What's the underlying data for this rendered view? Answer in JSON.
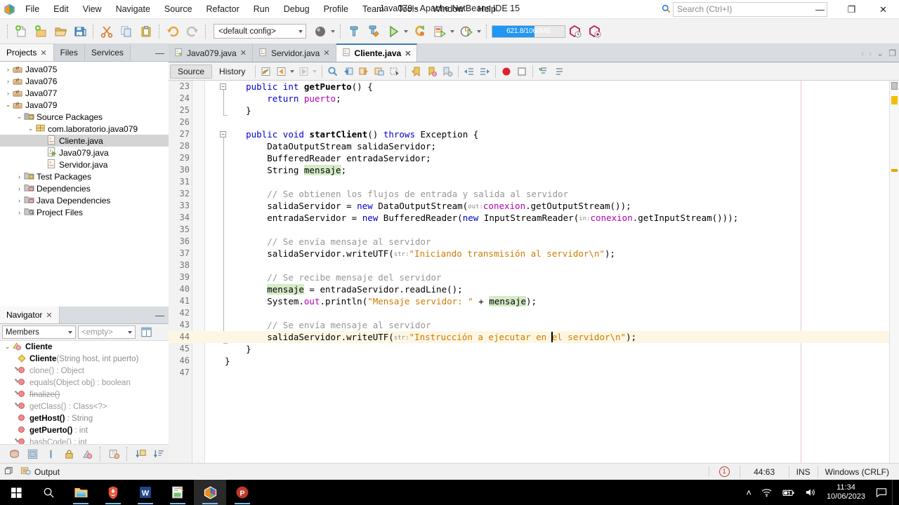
{
  "titlebar": {
    "app_title": "Java079 - Apache NetBeans IDE 15",
    "menus": [
      "File",
      "Edit",
      "View",
      "Navigate",
      "Source",
      "Refactor",
      "Run",
      "Debug",
      "Profile",
      "Team",
      "Tools",
      "Window",
      "Help"
    ],
    "search_placeholder": "Search (Ctrl+I)",
    "minimize": "—",
    "maximize": "❐",
    "close": "✕"
  },
  "toolbar": {
    "config_label": "<default config>",
    "memory_label": "621.8/1066MB",
    "memory_percent": 58,
    "buttons": [
      "new-file-icon",
      "new-project-icon",
      "open-project-icon",
      "save-all-icon",
      "cut-icon",
      "copy-icon",
      "paste-icon",
      "undo-icon",
      "redo-icon",
      "build-icon",
      "clean-build-icon",
      "run-icon",
      "debug-icon",
      "profile-icon",
      "test-icon"
    ]
  },
  "left_dock": {
    "tabs": [
      {
        "label": "Projects",
        "active": true,
        "closable": true
      },
      {
        "label": "Files",
        "active": false,
        "closable": false
      },
      {
        "label": "Services",
        "active": false,
        "closable": false
      }
    ],
    "minimize_glyph": "—",
    "tree": [
      {
        "label": "Java075",
        "depth": 0,
        "expander": "›",
        "icon": "java-project-icon",
        "selected": false
      },
      {
        "label": "Java076",
        "depth": 0,
        "expander": "›",
        "icon": "java-project-icon",
        "selected": false
      },
      {
        "label": "Java077",
        "depth": 0,
        "expander": "›",
        "icon": "java-project-icon",
        "selected": false
      },
      {
        "label": "Java079",
        "depth": 0,
        "expander": "⌄",
        "icon": "java-project-icon",
        "selected": false
      },
      {
        "label": "Source Packages",
        "depth": 1,
        "expander": "⌄",
        "icon": "source-packages-icon",
        "selected": false
      },
      {
        "label": "com.laboratorio.java079",
        "depth": 2,
        "expander": "⌄",
        "icon": "package-icon",
        "selected": false
      },
      {
        "label": "Cliente.java",
        "depth": 3,
        "expander": "",
        "icon": "java-class-icon",
        "selected": true
      },
      {
        "label": "Java079.java",
        "depth": 3,
        "expander": "",
        "icon": "java-main-class-icon",
        "selected": false
      },
      {
        "label": "Servidor.java",
        "depth": 3,
        "expander": "",
        "icon": "java-class-icon",
        "selected": false
      },
      {
        "label": "Test Packages",
        "depth": 1,
        "expander": "›",
        "icon": "test-packages-icon",
        "selected": false
      },
      {
        "label": "Dependencies",
        "depth": 1,
        "expander": "›",
        "icon": "dependencies-icon",
        "selected": false
      },
      {
        "label": "Java Dependencies",
        "depth": 1,
        "expander": "›",
        "icon": "dependencies-icon",
        "selected": false
      },
      {
        "label": "Project Files",
        "depth": 1,
        "expander": "›",
        "icon": "project-files-icon",
        "selected": false
      }
    ]
  },
  "navigator": {
    "tab_label": "Navigator",
    "minimize_glyph": "—",
    "view_select": "Members",
    "filter_select": "<empty>",
    "class_name": "Cliente",
    "members": [
      {
        "name": "Cliente",
        "signature": "(String host, int puerto)",
        "return_type": "",
        "icon": "constructor-icon",
        "inherited": false,
        "deprecated": false
      },
      {
        "name": "clone()",
        "signature": "",
        "return_type": " : Object",
        "icon": "method-icon",
        "inherited": true,
        "deprecated": false
      },
      {
        "name": "equals(Object obj)",
        "signature": "",
        "return_type": " : boolean",
        "icon": "method-icon",
        "inherited": true,
        "deprecated": false
      },
      {
        "name": "finalize()",
        "signature": "",
        "return_type": "",
        "icon": "method-icon",
        "inherited": true,
        "deprecated": true
      },
      {
        "name": "getClass()",
        "signature": "",
        "return_type": " : Class<?>",
        "icon": "method-icon",
        "inherited": true,
        "deprecated": false
      },
      {
        "name": "getHost()",
        "signature": "",
        "return_type": " : String",
        "icon": "method-icon",
        "inherited": false,
        "deprecated": false
      },
      {
        "name": "getPuerto()",
        "signature": "",
        "return_type": " : int",
        "icon": "method-icon",
        "inherited": false,
        "deprecated": false
      },
      {
        "name": "hashCode()",
        "signature": "",
        "return_type": " : int",
        "icon": "method-icon",
        "inherited": true,
        "deprecated": false
      }
    ]
  },
  "editor": {
    "tabs": [
      {
        "label": "Java079.java",
        "active": false,
        "icon": "java-main-class-icon"
      },
      {
        "label": "Servidor.java",
        "active": false,
        "icon": "java-class-icon"
      },
      {
        "label": "Cliente.java",
        "active": true,
        "icon": "java-class-icon"
      }
    ],
    "tab_controls": [
      "‹",
      "›",
      "⌄",
      "❐"
    ],
    "view_buttons": [
      {
        "label": "Source",
        "active": true
      },
      {
        "label": "History",
        "active": false
      }
    ],
    "toolbar_icons": [
      "last-edit-icon",
      "back-icon",
      "forward-icon",
      "find-selection-icon",
      "previous-bookmark-icon",
      "next-bookmark-icon",
      "toggle-bookmark-icon",
      "shift-line-icon",
      "previous-error-icon",
      "next-error-icon",
      "toggle-highlight-icon",
      "shift-left-icon",
      "shift-right-icon",
      "toggle-breakpoint-icon",
      "stop-icon",
      "comment-icon",
      "uncomment-icon"
    ],
    "caret_position": "44:63",
    "code_lines": [
      {
        "no": 23,
        "indent": 4,
        "tokens": [
          {
            "t": "public",
            "c": "kw"
          },
          {
            "t": " ",
            "c": ""
          },
          {
            "t": "int",
            "c": "kw"
          },
          {
            "t": " ",
            "c": ""
          },
          {
            "t": "getPuerto",
            "c": "mth"
          },
          {
            "t": "() {",
            "c": ""
          }
        ]
      },
      {
        "no": 24,
        "indent": 8,
        "tokens": [
          {
            "t": "return",
            "c": "kw"
          },
          {
            "t": " ",
            "c": ""
          },
          {
            "t": "puerto",
            "c": "fld"
          },
          {
            "t": ";",
            "c": ""
          }
        ]
      },
      {
        "no": 25,
        "indent": 4,
        "tokens": [
          {
            "t": "}",
            "c": ""
          }
        ]
      },
      {
        "no": 26,
        "indent": 0,
        "tokens": []
      },
      {
        "no": 27,
        "indent": 4,
        "tokens": [
          {
            "t": "public",
            "c": "kw"
          },
          {
            "t": " ",
            "c": ""
          },
          {
            "t": "void",
            "c": "kw"
          },
          {
            "t": " ",
            "c": ""
          },
          {
            "t": "startClient",
            "c": "mth"
          },
          {
            "t": "() ",
            "c": ""
          },
          {
            "t": "throws",
            "c": "kw"
          },
          {
            "t": " Exception {",
            "c": ""
          }
        ]
      },
      {
        "no": 28,
        "indent": 8,
        "tokens": [
          {
            "t": "DataOutputStream salidaServidor;",
            "c": ""
          }
        ]
      },
      {
        "no": 29,
        "indent": 8,
        "tokens": [
          {
            "t": "BufferedReader entradaServidor;",
            "c": ""
          }
        ]
      },
      {
        "no": 30,
        "indent": 8,
        "tokens": [
          {
            "t": "String ",
            "c": ""
          },
          {
            "t": "mensaje",
            "c": "hl"
          },
          {
            "t": ";",
            "c": ""
          }
        ]
      },
      {
        "no": 31,
        "indent": 0,
        "tokens": []
      },
      {
        "no": 32,
        "indent": 8,
        "tokens": [
          {
            "t": "// Se obtienen los flujos de entrada y salida al servidor",
            "c": "cm"
          }
        ]
      },
      {
        "no": 33,
        "indent": 8,
        "tokens": [
          {
            "t": "salidaServidor = ",
            "c": ""
          },
          {
            "t": "new",
            "c": "kw"
          },
          {
            "t": " DataOutputStream(",
            "c": ""
          },
          {
            "t": "out:",
            "c": "hint"
          },
          {
            "t": "",
            "c": ""
          },
          {
            "t": "conexion",
            "c": "fld"
          },
          {
            "t": ".getOutputStream());",
            "c": ""
          }
        ]
      },
      {
        "no": 34,
        "indent": 8,
        "tokens": [
          {
            "t": "entradaServidor = ",
            "c": ""
          },
          {
            "t": "new",
            "c": "kw"
          },
          {
            "t": " BufferedReader(",
            "c": ""
          },
          {
            "t": "new",
            "c": "kw"
          },
          {
            "t": " InputStreamReader(",
            "c": ""
          },
          {
            "t": "in:",
            "c": "hint"
          },
          {
            "t": "",
            "c": ""
          },
          {
            "t": "conexion",
            "c": "fld"
          },
          {
            "t": ".getInputStream()));",
            "c": ""
          }
        ]
      },
      {
        "no": 35,
        "indent": 0,
        "tokens": []
      },
      {
        "no": 36,
        "indent": 8,
        "tokens": [
          {
            "t": "// Se envía mensaje al servidor",
            "c": "cm"
          }
        ]
      },
      {
        "no": 37,
        "indent": 8,
        "tokens": [
          {
            "t": "salidaServidor.writeUTF(",
            "c": ""
          },
          {
            "t": "str:",
            "c": "hint"
          },
          {
            "t": "\"Iniciando transmisión al servidor\\n\"",
            "c": "str"
          },
          {
            "t": ");",
            "c": ""
          }
        ]
      },
      {
        "no": 38,
        "indent": 0,
        "tokens": []
      },
      {
        "no": 39,
        "indent": 8,
        "tokens": [
          {
            "t": "// Se recibe mensaje del servidor",
            "c": "cm"
          }
        ]
      },
      {
        "no": 40,
        "indent": 8,
        "tokens": [
          {
            "t": "mensaje",
            "c": "hl"
          },
          {
            "t": " = entradaServidor.readLine();",
            "c": ""
          }
        ]
      },
      {
        "no": 41,
        "indent": 8,
        "tokens": [
          {
            "t": "System.",
            "c": ""
          },
          {
            "t": "out",
            "c": "fld"
          },
          {
            "t": ".println(",
            "c": ""
          },
          {
            "t": "\"Mensaje servidor: \"",
            "c": "str"
          },
          {
            "t": " + ",
            "c": ""
          },
          {
            "t": "mensaje",
            "c": "hl"
          },
          {
            "t": ");",
            "c": ""
          }
        ]
      },
      {
        "no": 42,
        "indent": 0,
        "tokens": []
      },
      {
        "no": 43,
        "indent": 8,
        "tokens": [
          {
            "t": "// Se envía mensaje al servidor",
            "c": "cm"
          }
        ]
      },
      {
        "no": 44,
        "indent": 8,
        "current": true,
        "tokens": [
          {
            "t": "salidaServidor.writeUTF(",
            "c": ""
          },
          {
            "t": "str:",
            "c": "hint"
          },
          {
            "t": "\"Instrucción a ejecutar en el servidor\\n\"",
            "c": "str"
          },
          {
            "t": ");",
            "c": ""
          }
        ]
      },
      {
        "no": 45,
        "indent": 4,
        "tokens": [
          {
            "t": "}",
            "c": ""
          }
        ]
      },
      {
        "no": 46,
        "indent": 0,
        "tokens": [
          {
            "t": "}",
            "c": ""
          }
        ]
      },
      {
        "no": 47,
        "indent": 0,
        "tokens": []
      }
    ]
  },
  "statusbar": {
    "output_label": "Output",
    "warning_count": "1",
    "caret": "44:63",
    "insert_mode": "INS",
    "line_ending": "Windows (CRLF)"
  },
  "taskbar": {
    "items": [
      {
        "name": "start-button",
        "glyph": "start-icon"
      },
      {
        "name": "search-button",
        "glyph": "search-icon"
      },
      {
        "name": "file-explorer",
        "glyph": "folder-icon"
      },
      {
        "name": "brave-browser",
        "glyph": "brave-icon"
      },
      {
        "name": "word",
        "glyph": "word-icon"
      },
      {
        "name": "editor-app",
        "glyph": "editor-icon"
      },
      {
        "name": "netbeans",
        "glyph": "netbeans-icon",
        "active": true
      },
      {
        "name": "powerpoint",
        "glyph": "powerpoint-icon"
      }
    ],
    "tray": {
      "chevron": "˄",
      "wifi": "wifi-icon",
      "battery": "battery-icon",
      "volume": "volume-icon",
      "time": "11:34",
      "date": "10/06/2023",
      "notifications": "notification-icon"
    }
  },
  "colors": {
    "accent_blue": "#2196f3",
    "keyword": "#0000cc",
    "string": "#ce7b00",
    "comment": "#969696",
    "field": "#b000b0",
    "highlight": "#d5ebc8",
    "current_line": "#fdf6e3"
  }
}
